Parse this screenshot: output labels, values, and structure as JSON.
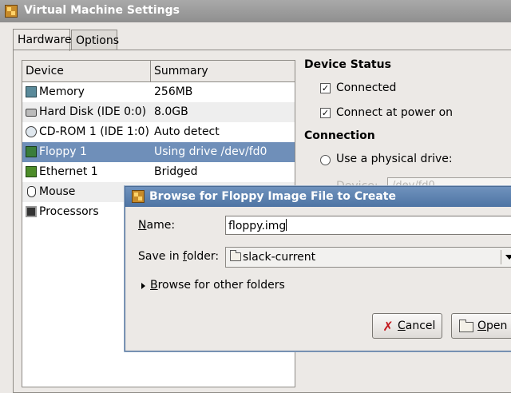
{
  "window": {
    "title": "Virtual Machine Settings"
  },
  "tabs": [
    {
      "label": "Hardware",
      "active": true
    },
    {
      "label": "Options",
      "active": false
    }
  ],
  "device_list": {
    "columns": [
      "Device",
      "Summary"
    ],
    "rows": [
      {
        "name": "Memory",
        "summary": "256MB",
        "icon": "memory-icon"
      },
      {
        "name": "Hard Disk (IDE 0:0)",
        "summary": "8.0GB",
        "icon": "hard-disk-icon"
      },
      {
        "name": "CD-ROM 1 (IDE 1:0)",
        "summary": "Auto detect",
        "icon": "cdrom-icon"
      },
      {
        "name": "Floppy 1",
        "summary": "Using drive /dev/fd0",
        "icon": "floppy-icon",
        "selected": true
      },
      {
        "name": "Ethernet 1",
        "summary": "Bridged",
        "icon": "ethernet-icon"
      },
      {
        "name": "Mouse",
        "summary": "",
        "icon": "mouse-icon"
      },
      {
        "name": "Processors",
        "summary": "",
        "icon": "processor-icon"
      }
    ]
  },
  "device_status": {
    "heading": "Device Status",
    "connected": {
      "label": "Connected",
      "checked": true
    },
    "connect_at_power_on": {
      "label": "Connect at power on",
      "checked": true
    }
  },
  "connection": {
    "heading": "Connection",
    "physical_drive_label": "Use a physical drive:",
    "device_label": "Device:",
    "device_value": "/dev/fd0"
  },
  "dialog": {
    "title": "Browse for Floppy Image File to Create",
    "name_label_mnemonic": "N",
    "name_label_rest": "ame:",
    "name_value": "floppy.img",
    "folder_label_pre": "Save in ",
    "folder_label_mnemonic": "f",
    "folder_label_rest": "older:",
    "folder_value": "slack-current",
    "browse_mnemonic": "B",
    "browse_rest": "rowse for other folders",
    "cancel_mnemonic": "C",
    "cancel_rest": "ancel",
    "open_mnemonic": "O",
    "open_rest": "pen"
  },
  "colors": {
    "selection": "#6f8fb9",
    "dialog_titlebar": "#5a7fae",
    "window_titlebar": "#9a9a9a"
  }
}
